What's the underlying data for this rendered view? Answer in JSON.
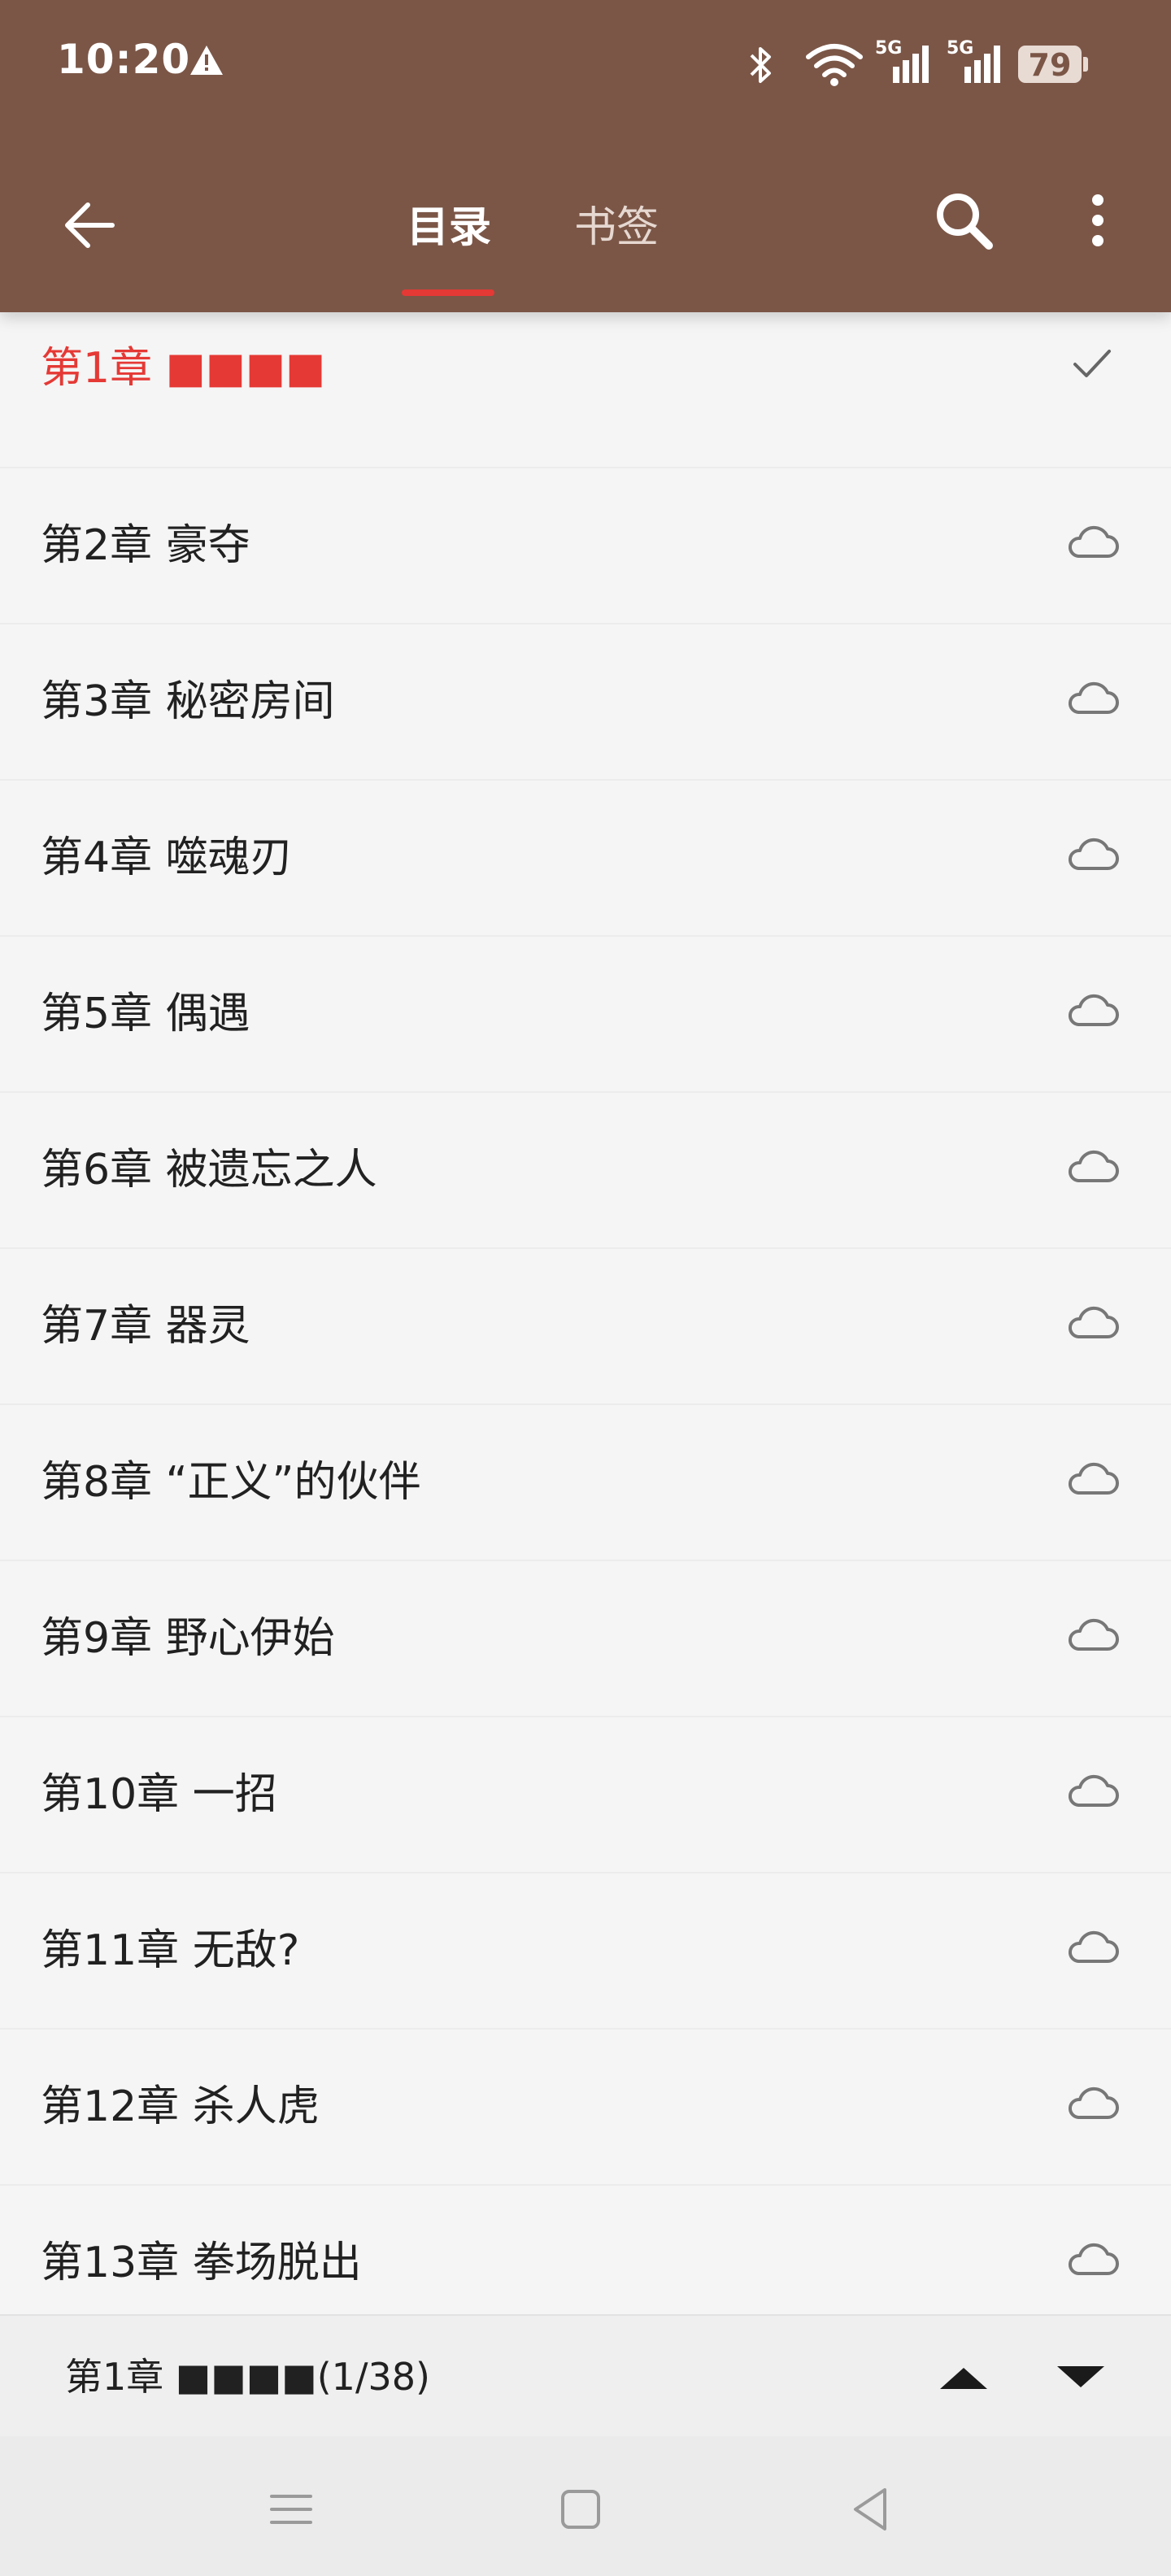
{
  "status_bar": {
    "time": "10:20",
    "battery": "79",
    "network_label_1": "5G",
    "network_label_2": "5G",
    "icons": [
      "warning-icon",
      "bluetooth-icon",
      "wifi-icon",
      "signal-icon",
      "signal-icon",
      "battery-icon"
    ]
  },
  "app_bar": {
    "tabs": [
      {
        "label": "目录",
        "active": true
      },
      {
        "label": "书签",
        "active": false
      }
    ],
    "icons": [
      "back-arrow-icon",
      "search-icon",
      "more-vert-icon"
    ],
    "colors": {
      "background": "#7b5647",
      "indicator": "#e53935"
    }
  },
  "chapters": [
    {
      "title": "第1章 ■■■■",
      "status": "current",
      "icon": "check-icon"
    },
    {
      "title": "第2章 豪夺",
      "status": "cloud",
      "icon": "cloud-icon"
    },
    {
      "title": "第3章 秘密房间",
      "status": "cloud",
      "icon": "cloud-icon"
    },
    {
      "title": "第4章 噬魂刃",
      "status": "cloud",
      "icon": "cloud-icon"
    },
    {
      "title": "第5章 偶遇",
      "status": "cloud",
      "icon": "cloud-icon"
    },
    {
      "title": "第6章 被遗忘之人",
      "status": "cloud",
      "icon": "cloud-icon"
    },
    {
      "title": "第7章 器灵",
      "status": "cloud",
      "icon": "cloud-icon"
    },
    {
      "title": "第8章 “正义”的伙伴",
      "status": "cloud",
      "icon": "cloud-icon"
    },
    {
      "title": "第9章 野心伊始",
      "status": "cloud",
      "icon": "cloud-icon"
    },
    {
      "title": "第10章 一招",
      "status": "cloud",
      "icon": "cloud-icon"
    },
    {
      "title": "第11章 无敌?",
      "status": "cloud",
      "icon": "cloud-icon"
    },
    {
      "title": "第12章 杀人虎",
      "status": "cloud",
      "icon": "cloud-icon"
    },
    {
      "title": "第13章 拳场脱出",
      "status": "cloud",
      "icon": "cloud-icon"
    }
  ],
  "bottom_bar": {
    "current_chapter": "第1章 ■■■■(1/38)",
    "icons": [
      "arrow-up-icon",
      "arrow-down-icon"
    ]
  },
  "nav_bar": {
    "icons": [
      "menu-icon",
      "home-square-icon",
      "back-triangle-icon"
    ]
  }
}
